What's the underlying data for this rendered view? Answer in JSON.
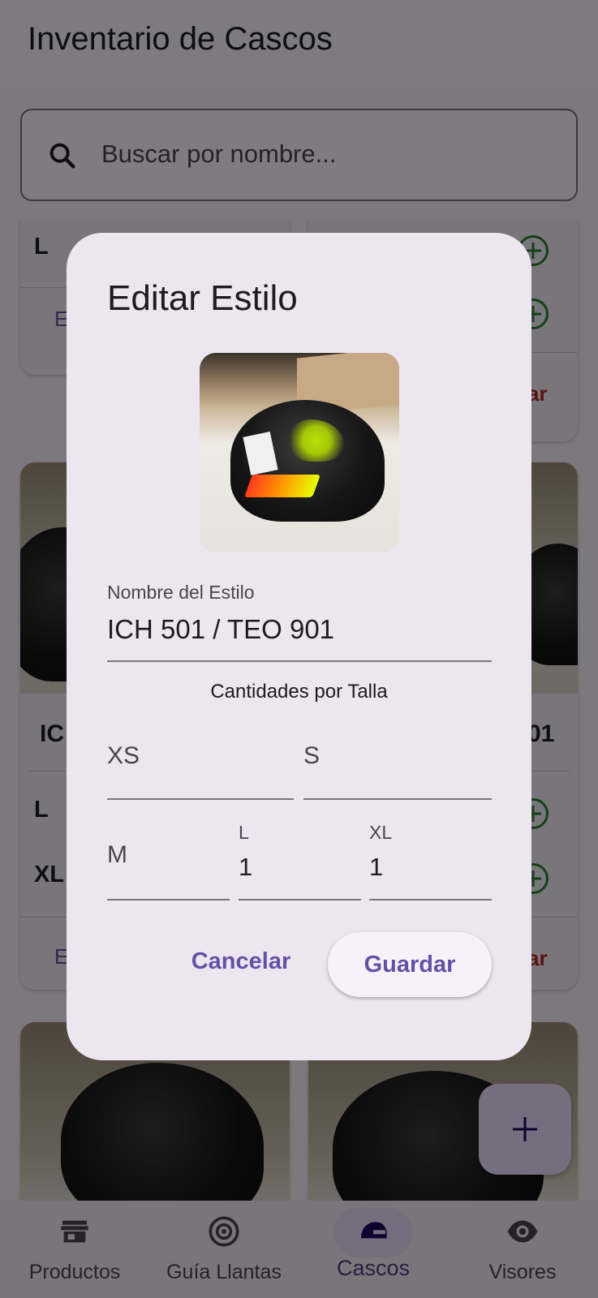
{
  "app": {
    "title": "Inventario de Cascos"
  },
  "search": {
    "placeholder": "Buscar por nombre...",
    "icon": "search-icon"
  },
  "background_cards": {
    "card1_sizes": [
      "L"
    ],
    "card1_edit_label": "E",
    "card2_delete_label": "ar",
    "card3_name": "IC",
    "card3_sizes": [
      "L",
      "XL"
    ],
    "card3_edit_label": "E",
    "card4_name": "01",
    "card4_delete_label": "ar"
  },
  "fab": {
    "icon": "plus-icon"
  },
  "bottom_nav": {
    "items": [
      {
        "label": "Productos",
        "icon": "store-icon",
        "active": false
      },
      {
        "label": "Guía Llantas",
        "icon": "tire-icon",
        "active": false
      },
      {
        "label": "Cascos",
        "icon": "helmet-icon",
        "active": true
      },
      {
        "label": "Visores",
        "icon": "eye-icon",
        "active": false
      }
    ]
  },
  "dialog": {
    "title": "Editar Estilo",
    "name_field": {
      "label": "Nombre del Estilo",
      "value": "ICH 501 / TEO 901"
    },
    "section_title": "Cantidades por Talla",
    "sizes": {
      "xs": {
        "label": "XS",
        "value": ""
      },
      "s": {
        "label": "S",
        "value": ""
      },
      "m": {
        "label": "M",
        "value": ""
      },
      "l": {
        "label": "L",
        "value": "1"
      },
      "xl": {
        "label": "XL",
        "value": "1"
      }
    },
    "cancel_label": "Cancelar",
    "save_label": "Guardar"
  },
  "colors": {
    "primary": "#6750a4",
    "surface": "#ece6f0",
    "add_green": "#2e7d32",
    "delete_red": "#b3261e"
  }
}
